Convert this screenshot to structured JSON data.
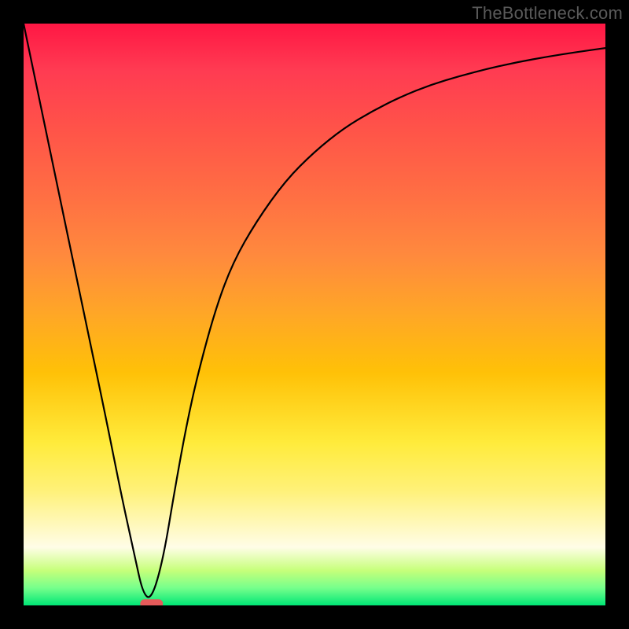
{
  "watermark": "TheBottleneck.com",
  "chart_data": {
    "type": "line",
    "title": "",
    "xlabel": "",
    "ylabel": "",
    "xlim": [
      0,
      100
    ],
    "ylim": [
      0,
      100
    ],
    "x": [
      0,
      5,
      10,
      14,
      17,
      19,
      20.5,
      22,
      24,
      26,
      28,
      30,
      33,
      36,
      40,
      45,
      50,
      55,
      60,
      65,
      70,
      75,
      80,
      85,
      90,
      95,
      100
    ],
    "y": [
      100,
      76,
      52,
      33,
      18,
      9,
      2,
      1,
      8,
      20,
      31,
      40,
      51,
      59,
      66,
      73,
      78,
      82,
      85,
      87.5,
      89.5,
      91,
      92.3,
      93.4,
      94.3,
      95.1,
      95.8
    ],
    "grid": false,
    "legend": false,
    "marker": {
      "x": 22,
      "y": 0.3
    },
    "gradient_stops": [
      {
        "pos": 0.0,
        "color": "#ff1744"
      },
      {
        "pos": 0.5,
        "color": "#ffc107"
      },
      {
        "pos": 0.8,
        "color": "#fff176"
      },
      {
        "pos": 1.0,
        "color": "#00e676"
      }
    ]
  }
}
